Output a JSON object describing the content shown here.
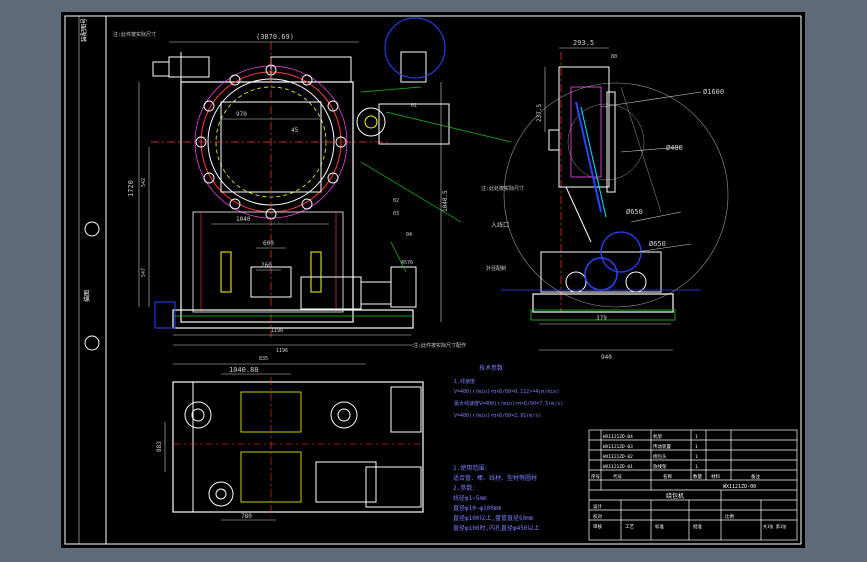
{
  "side_strip": {
    "label_top": "装配图号",
    "label_mid": "描图"
  },
  "dims": {
    "overall_width": "(3870.69)",
    "top_right_width": "293.5",
    "top_right_small": "80",
    "ring_inner": "970",
    "ring_offset": "45",
    "lower_span": "1040",
    "motor_span": "600",
    "center_small": "260",
    "height_main": "1720",
    "height_mid": "542",
    "height_lower": "547",
    "height_right": "1040.5",
    "base_width": "1198",
    "base_total": "1196",
    "dia_large": "Ø1600",
    "dia_mid": "Ø480",
    "dia_r1": "Ø650",
    "dia_r2": "Ø650",
    "side_base": "379",
    "side_total": "940",
    "side_height": "237.5",
    "plan_width": "1040.88",
    "plan_offset": "835",
    "plan_height": "883",
    "plan_bottom": "780",
    "callout_right_low": "4576"
  },
  "notes": {
    "tech_title": "技术参数",
    "params": [
      "1.线速度",
      "V=400(r/min)×π×D/60=0.112×=4(m/min)",
      "最大线速度V=400(r/min)×π×D/60=7.5(m/s)",
      "V=400(r/min)×π×D/60=2.91(m/s)"
    ],
    "req_lines": [
      "1.使用范围:",
      "适合管、棒、线材、型材等圆材",
      "2.参数:",
      "线径φ1~5mm",
      "直径φ10~φ100mm",
      "直径φ100以上,盘管直径50mm",
      "直径φ100时,内孔直径φ450以上"
    ]
  },
  "title_block": {
    "rows": [
      {
        "code": "WX1121ZD-04",
        "name": "机架",
        "qty": "1"
      },
      {
        "code": "WX1121ZD-03",
        "name": "传动装置",
        "qty": "1"
      },
      {
        "code": "WX1121ZD-02",
        "name": "绕包头",
        "qty": "1"
      },
      {
        "code": "WX1121ZD-01",
        "name": "放线架",
        "qty": "1"
      }
    ],
    "drawing_no": "WX1121ZD-00",
    "drawing_name": "绕包机",
    "col_labels": [
      "序号",
      "代号",
      "名称",
      "数量",
      "材料",
      "备注"
    ],
    "sign_labels": [
      "设计",
      "校对",
      "审核",
      "工艺",
      "标准",
      "批准"
    ],
    "scale_label": "比例",
    "sheet_label": "共1张 第1张"
  },
  "callouts": {
    "top_left": "注:此件按实际尺寸",
    "side_mid": "注:此处按实际尺寸",
    "bottom_right": "注:此件按实际尺寸配作",
    "entry_label": "入线口",
    "side_note": "外径配制",
    "tag_01": "01",
    "tag_02": "02",
    "tag_03": "03",
    "tag_04": "04"
  },
  "colors": {
    "outline": "#ffffff",
    "center_line": "#ff3b3b",
    "dim_line": "#d0d0d0",
    "construction": "#ffff00",
    "accent_blue": "#2b45ff",
    "accent_cyan": "#00e6ff",
    "accent_green": "#1cc81c",
    "accent_magenta": "#ff4cff",
    "notes_text": "#7f7fff"
  }
}
